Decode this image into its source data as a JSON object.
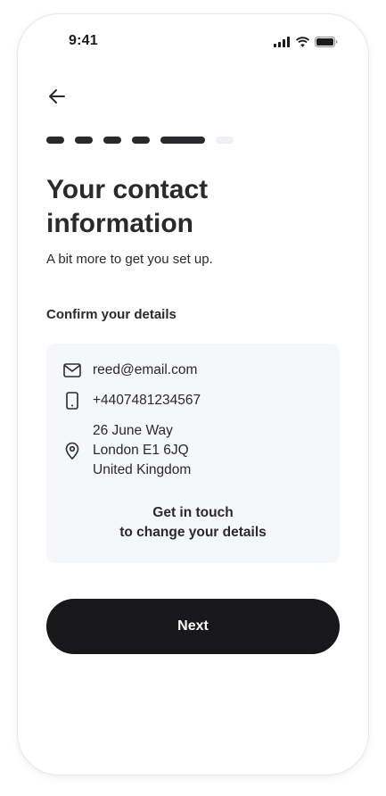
{
  "status_bar": {
    "time": "9:41",
    "icons": [
      "cellular-signal-icon",
      "wifi-icon",
      "battery-icon"
    ]
  },
  "header": {
    "back_icon": "arrow-left-icon"
  },
  "progress": {
    "completed_steps": 5,
    "total_steps": 6,
    "current_step": 5
  },
  "title": "Your contact information",
  "subtitle": "A bit more to get you set up.",
  "details": {
    "section_label": "Confirm your details",
    "email": "reed@email.com",
    "phone": "+4407481234567",
    "address": {
      "line1": "26 June Way",
      "line2": "London E1 6JQ",
      "line3": "United Kingdom"
    },
    "contact_link": {
      "line1": "Get in touch",
      "line2": "to change your details"
    }
  },
  "next_button": {
    "label": "Next"
  },
  "colors": {
    "primary": "#18181b",
    "text": "#2a2a2d",
    "card_bg": "#f6f7fb",
    "progress_pending": "#eef0f5"
  }
}
